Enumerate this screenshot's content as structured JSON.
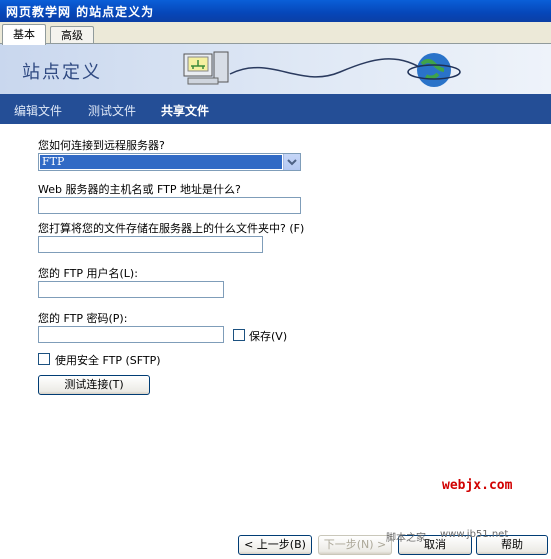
{
  "window": {
    "title": "网页教学网 的站点定义为"
  },
  "tabs": [
    {
      "label": "基本"
    },
    {
      "label": "高级"
    }
  ],
  "banner": {
    "title": "站点定义"
  },
  "nav": [
    {
      "label": "编辑文件"
    },
    {
      "label": "测试文件"
    },
    {
      "label": "共享文件"
    }
  ],
  "form": {
    "connect_question": "您如何连接到远程服务器?",
    "connect_value": "FTP",
    "host_question": "Web 服务器的主机名或 FTP 地址是什么?",
    "host_value": "",
    "folder_question": "您打算将您的文件存储在服务器上的什么文件夹中? (F)",
    "folder_value": "",
    "user_label": "您的 FTP 用户名(L):",
    "user_value": "",
    "password_label": "您的 FTP 密码(P):",
    "password_value": "",
    "save_label": "保存(V)",
    "sftp_label": "使用安全 FTP (SFTP)",
    "test_button": "测试连接(T)"
  },
  "watermark": {
    "red": "webjx.com",
    "gray1": "脚本之家",
    "gray2": "www.jb51.net"
  },
  "footer": {
    "back": "< 上一步(B)",
    "next": "下一步(N) >",
    "cancel": "取消",
    "help": "帮助"
  }
}
